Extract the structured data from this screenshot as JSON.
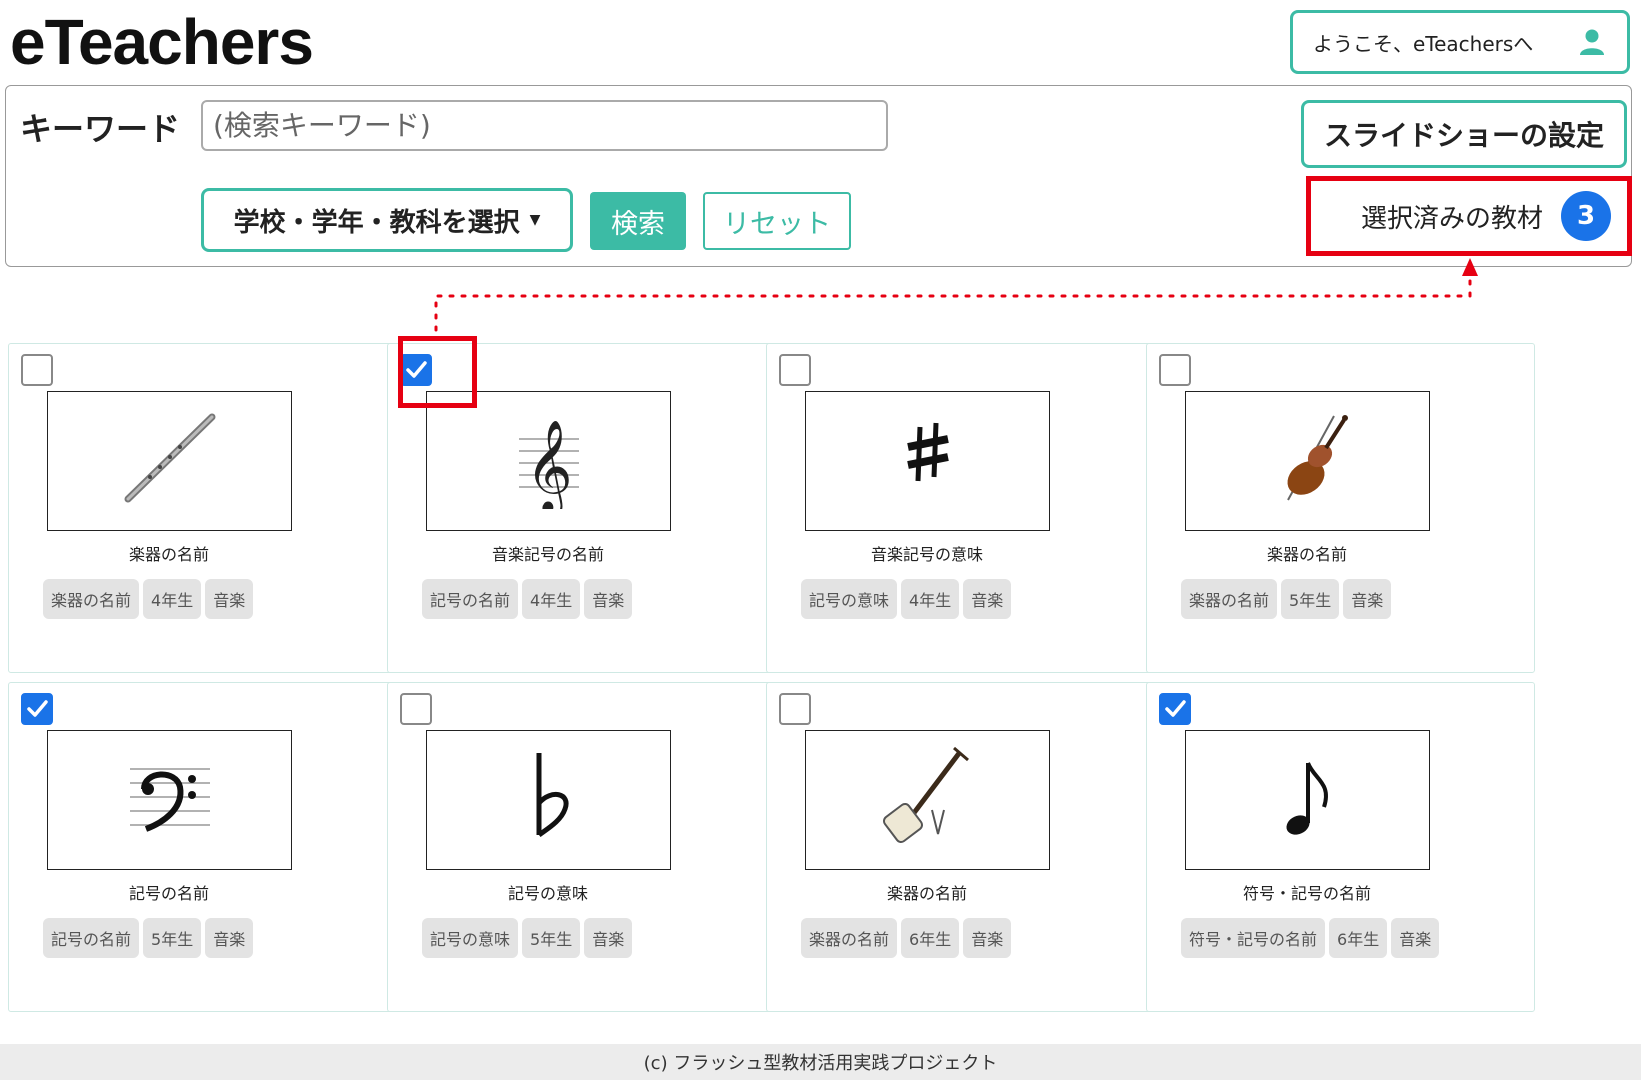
{
  "header": {
    "logo": "eTeachers",
    "welcome_text": "ようこそ、eTeachersへ",
    "user_icon": "user-icon"
  },
  "search": {
    "keyword_label": "キーワード",
    "placeholder": "(検索キーワード)",
    "value": "",
    "select_label": "学校・学年・教科を選択",
    "select_caret": "▼",
    "search_button": "検索",
    "reset_button": "リセット"
  },
  "right_panel": {
    "slideshow_button": "スライドショーの設定",
    "selected_label": "選択済みの教材",
    "selected_count": "3"
  },
  "accent_colors": {
    "teal": "#3cbba5",
    "blue": "#1a73e8",
    "red": "#e60012"
  },
  "cards": [
    {
      "checked": false,
      "icon": "flute-icon",
      "title": "楽器の名前",
      "tags": [
        "楽器の名前",
        "4年生",
        "音楽"
      ]
    },
    {
      "checked": true,
      "icon": "treble-clef-icon",
      "title": "音楽記号の名前",
      "tags": [
        "記号の名前",
        "4年生",
        "音楽"
      ]
    },
    {
      "checked": false,
      "icon": "sharp-icon",
      "title": "音楽記号の意味",
      "tags": [
        "記号の意味",
        "4年生",
        "音楽"
      ]
    },
    {
      "checked": false,
      "icon": "violin-icon",
      "title": "楽器の名前",
      "tags": [
        "楽器の名前",
        "5年生",
        "音楽"
      ]
    },
    {
      "checked": true,
      "icon": "bass-clef-icon",
      "title": "記号の名前",
      "tags": [
        "記号の名前",
        "5年生",
        "音楽"
      ]
    },
    {
      "checked": false,
      "icon": "flat-icon",
      "title": "記号の意味",
      "tags": [
        "記号の意味",
        "5年生",
        "音楽"
      ]
    },
    {
      "checked": false,
      "icon": "shamisen-icon",
      "title": "楽器の名前",
      "tags": [
        "楽器の名前",
        "6年生",
        "音楽"
      ]
    },
    {
      "checked": true,
      "icon": "eighth-note-icon",
      "title": "符号・記号の名前",
      "tags": [
        "符号・記号の名前",
        "6年生",
        "音楽"
      ]
    }
  ],
  "footer": {
    "text": "(c) フラッシュ型教材活用実践プロジェクト"
  }
}
